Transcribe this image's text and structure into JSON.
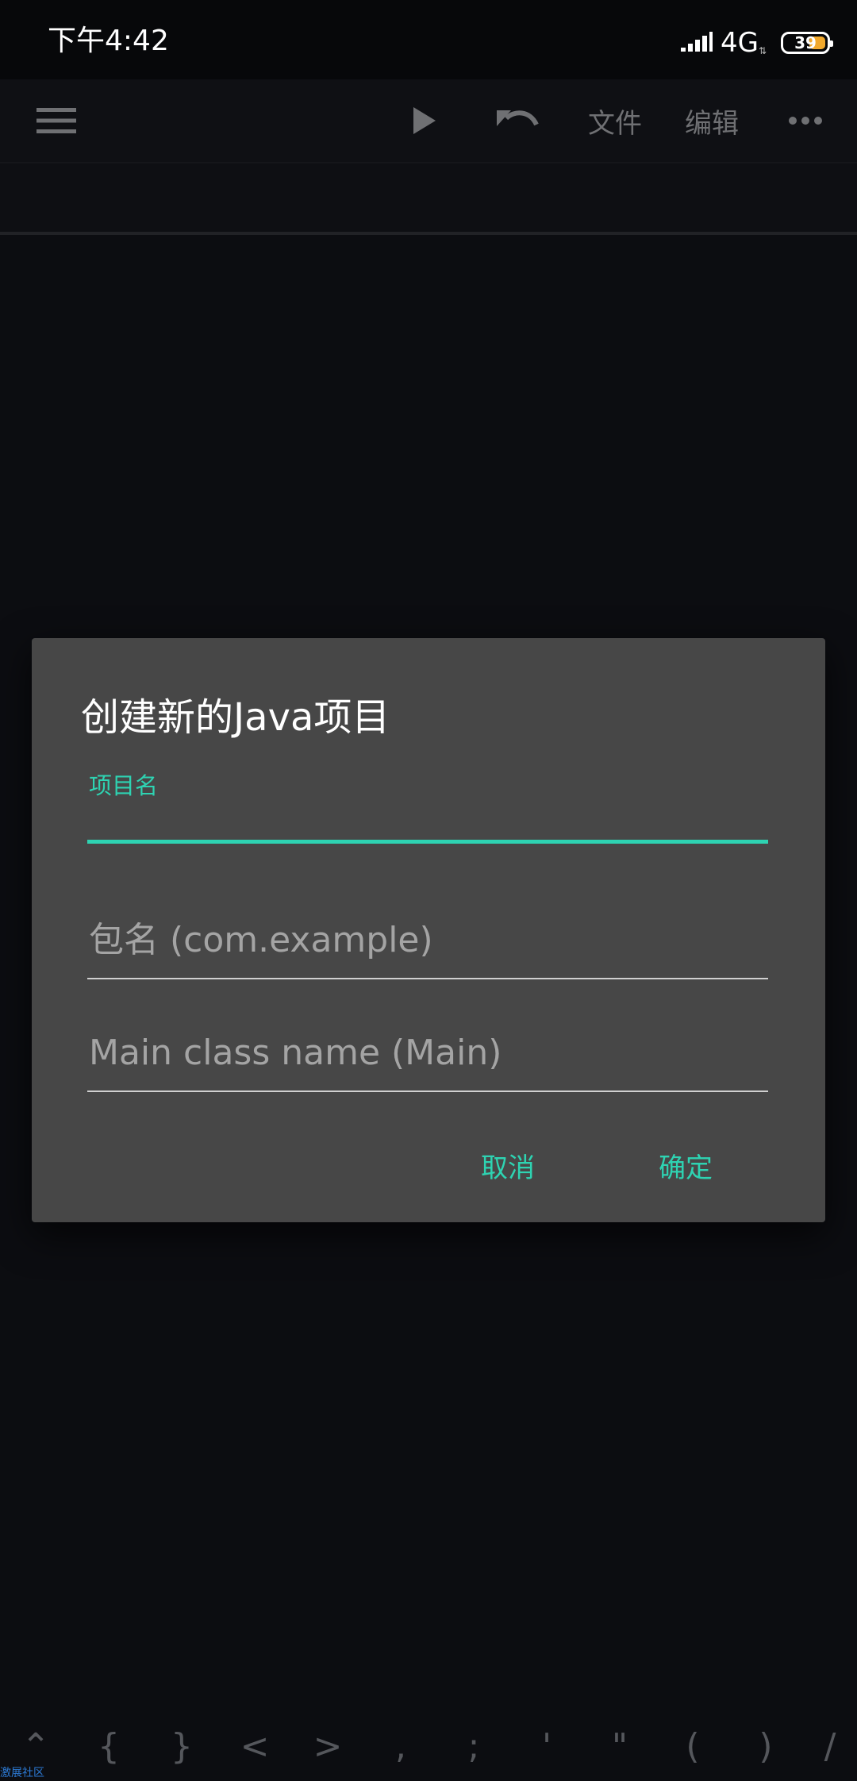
{
  "status_bar": {
    "time": "下午4:42",
    "network": "4G",
    "net_arrows": "⇅",
    "battery_level": "39",
    "battery_color": "#f2a92c"
  },
  "toolbar": {
    "menu_icon": "hamburger-menu-icon",
    "run_icon": "play-icon",
    "undo_icon": "undo-icon",
    "file_label": "文件",
    "edit_label": "编辑",
    "more_icon": "more-horizontal-icon"
  },
  "dialog": {
    "title": "创建新的Java项目",
    "project_name": {
      "label": "项目名",
      "value": ""
    },
    "package_name": {
      "placeholder": "包名 (com.example)"
    },
    "main_class": {
      "placeholder": "Main class name (Main)"
    },
    "cancel_label": "取消",
    "ok_label": "确定",
    "accent_color": "#2ed3b2"
  },
  "symbol_bar": {
    "keys": [
      "⌃",
      "{",
      "}",
      "<",
      ">",
      ",",
      ";",
      "'",
      "\"",
      "(",
      ")",
      "/"
    ]
  },
  "watermark": "激展社区"
}
